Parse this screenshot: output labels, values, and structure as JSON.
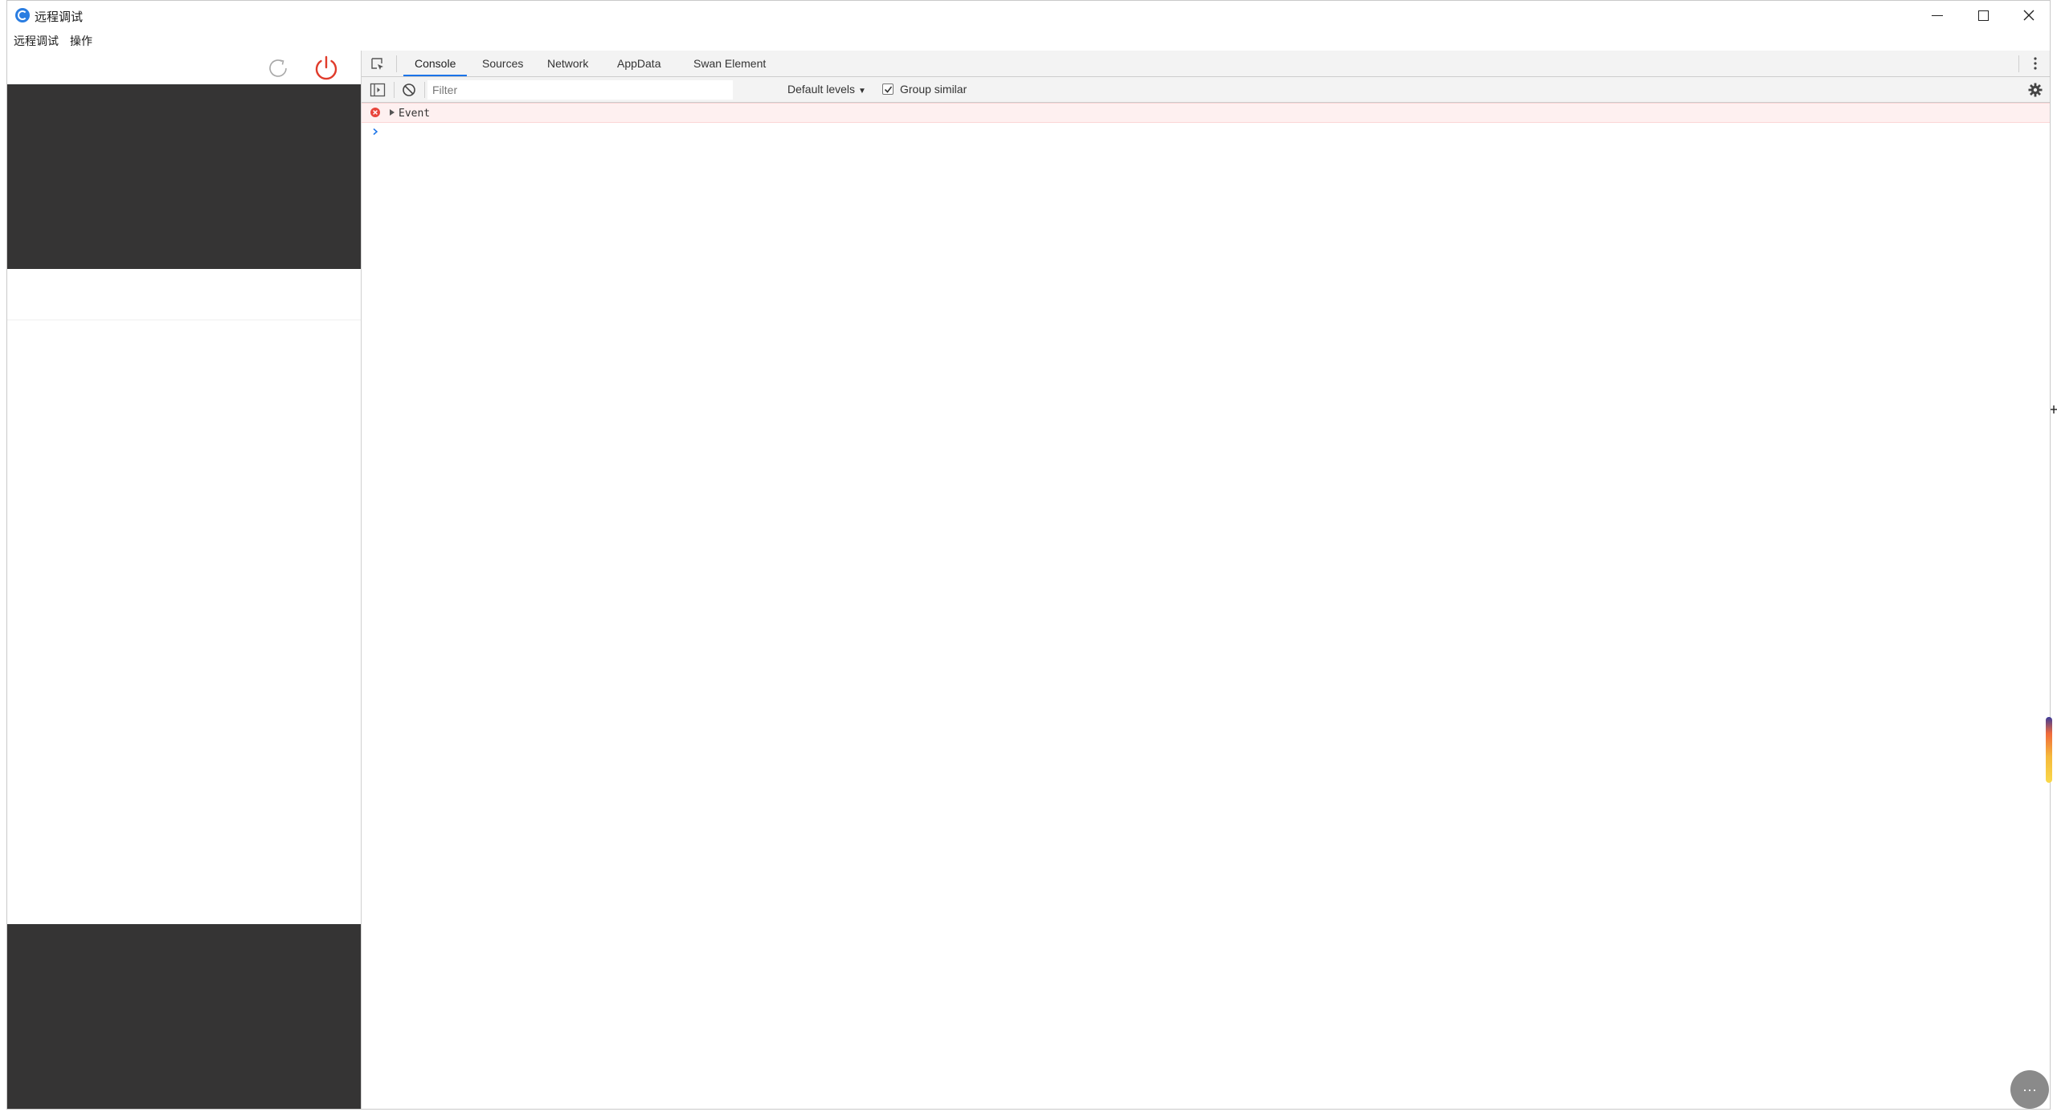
{
  "window": {
    "title": "远程调试",
    "controls": {
      "minimize_icon": "minimize-icon",
      "maximize_icon": "maximize-icon",
      "close_icon": "close-icon"
    }
  },
  "menubar": {
    "items": [
      {
        "label": "远程调试"
      },
      {
        "label": "操作"
      }
    ]
  },
  "left_toolbar": {
    "refresh_icon": "refresh-icon",
    "power_icon": "power-icon",
    "power_color": "#e03b2b"
  },
  "phone_preview": {
    "background": "#353434"
  },
  "devtools": {
    "tabs": [
      {
        "label": "Console",
        "active": true
      },
      {
        "label": "Sources",
        "active": false
      },
      {
        "label": "Network",
        "active": false
      },
      {
        "label": "AppData",
        "active": false
      },
      {
        "label": "Swan Element",
        "active": false
      }
    ],
    "accent": "#1a73e8",
    "toolbar": {
      "filter_placeholder": "Filter",
      "levels_label": "Default levels",
      "group_similar_label": "Group similar",
      "group_similar_checked": true
    },
    "console": {
      "messages": [
        {
          "level": "error",
          "text": "Event"
        }
      ],
      "error_color": "#e8453c"
    }
  },
  "float_button": {
    "label": "···"
  }
}
